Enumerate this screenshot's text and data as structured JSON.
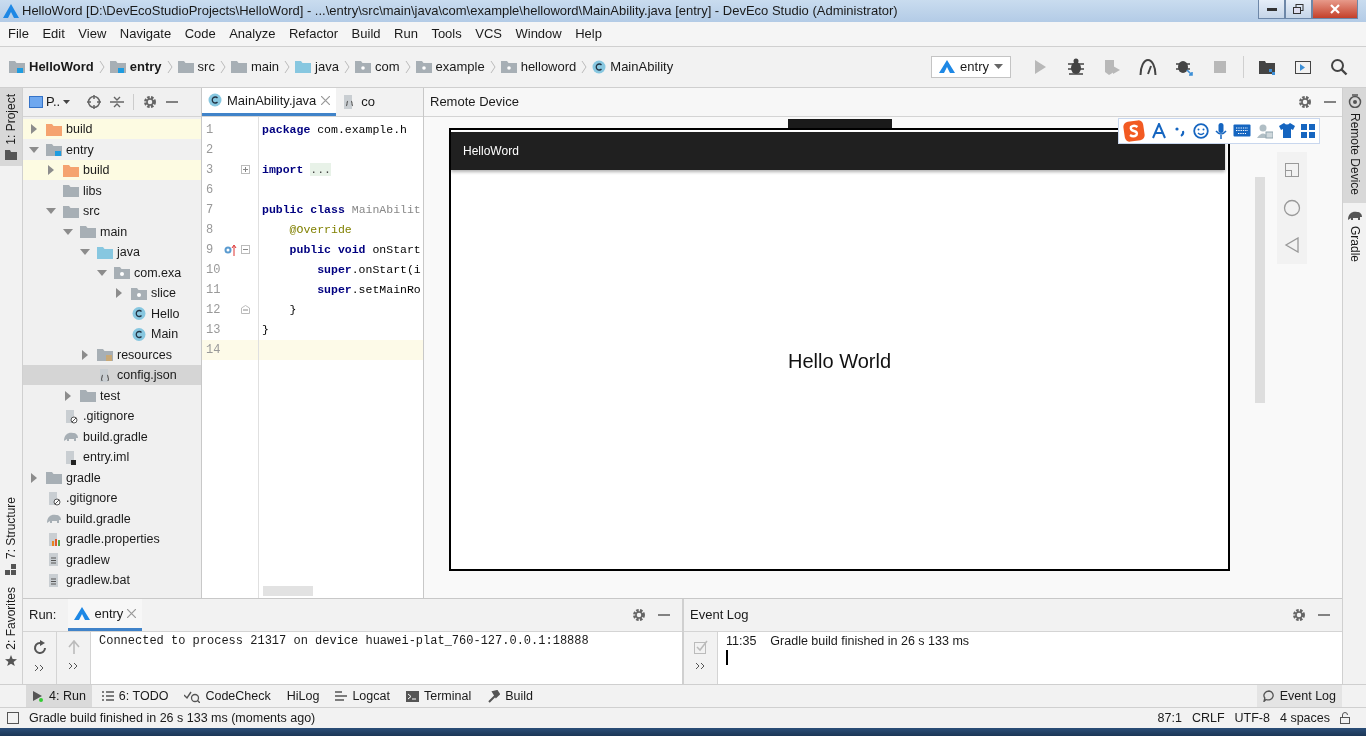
{
  "window": {
    "title": "HelloWord [D:\\DevEcoStudioProjects\\HelloWord] - ...\\entry\\src\\main\\java\\com\\example\\helloword\\MainAbility.java [entry] - DevEco Studio (Administrator)"
  },
  "menu": [
    "File",
    "Edit",
    "View",
    "Navigate",
    "Code",
    "Analyze",
    "Refactor",
    "Build",
    "Run",
    "Tools",
    "VCS",
    "Window",
    "Help"
  ],
  "breadcrumbs": [
    {
      "label": "HelloWord",
      "kind": "module"
    },
    {
      "label": "entry",
      "kind": "module"
    },
    {
      "label": "src",
      "kind": "folder"
    },
    {
      "label": "main",
      "kind": "folder"
    },
    {
      "label": "java",
      "kind": "source"
    },
    {
      "label": "com",
      "kind": "package"
    },
    {
      "label": "example",
      "kind": "package"
    },
    {
      "label": "helloword",
      "kind": "package"
    },
    {
      "label": "MainAbility",
      "kind": "class"
    }
  ],
  "run_config": {
    "label": "entry"
  },
  "toolbar": [
    {
      "kind": "run",
      "disabled": true
    },
    {
      "kind": "debug",
      "disabled": false
    },
    {
      "kind": "attach",
      "disabled": true
    },
    {
      "kind": "profile",
      "disabled": false
    },
    {
      "kind": "attach-debugger",
      "disabled": false
    },
    {
      "kind": "stop",
      "disabled": true
    },
    {
      "kind": "project-structure",
      "disabled": false
    },
    {
      "kind": "device-manager",
      "disabled": false
    },
    {
      "kind": "search",
      "disabled": false
    }
  ],
  "left_stripe": [
    {
      "label": "1: Project",
      "selected": true,
      "kind": "project"
    },
    {
      "label": "7: Structure",
      "selected": false,
      "kind": "structure"
    },
    {
      "label": "2: Favorites",
      "selected": false,
      "kind": "favorites"
    }
  ],
  "project_panel": {
    "title": "P..",
    "tree": [
      {
        "label": "build",
        "kind": "build",
        "expanded": false,
        "selected": false
      },
      {
        "label": "entry",
        "kind": "module",
        "expanded": true,
        "selected": false,
        "children": [
          {
            "label": "build",
            "kind": "build",
            "expanded": false,
            "selected": false
          },
          {
            "label": "libs",
            "kind": "folder",
            "selected": false
          },
          {
            "label": "src",
            "kind": "folder",
            "expanded": true,
            "selected": false,
            "children": [
              {
                "label": "main",
                "kind": "folder",
                "expanded": true,
                "selected": false,
                "children": [
                  {
                    "label": "java",
                    "kind": "source",
                    "expanded": true,
                    "selected": false,
                    "children": [
                      {
                        "label": "com.exa",
                        "kind": "package",
                        "expanded": true,
                        "selected": false,
                        "children": [
                          {
                            "label": "slice",
                            "kind": "package",
                            "expanded": false,
                            "selected": false
                          },
                          {
                            "label": "Hello",
                            "kind": "class",
                            "selected": false
                          },
                          {
                            "label": "Main",
                            "kind": "class",
                            "selected": false
                          }
                        ]
                      }
                    ]
                  },
                  {
                    "label": "resources",
                    "kind": "resources",
                    "expanded": false,
                    "selected": false
                  },
                  {
                    "label": "config.json",
                    "kind": "json",
                    "selected": true
                  }
                ]
              },
              {
                "label": "test",
                "kind": "folder",
                "expanded": false,
                "selected": false
              }
            ]
          },
          {
            "label": ".gitignore",
            "kind": "gitignore",
            "selected": false
          },
          {
            "label": "build.gradle",
            "kind": "gradle",
            "selected": false
          },
          {
            "label": "entry.iml",
            "kind": "iml",
            "selected": false
          }
        ]
      },
      {
        "label": "gradle",
        "kind": "folder",
        "expanded": false,
        "selected": false
      },
      {
        "label": ".gitignore",
        "kind": "gitignore",
        "selected": false
      },
      {
        "label": "build.gradle",
        "kind": "gradle",
        "selected": false
      },
      {
        "label": "gradle.properties",
        "kind": "properties",
        "selected": false
      },
      {
        "label": "gradlew",
        "kind": "text",
        "selected": false
      },
      {
        "label": "gradlew.bat",
        "kind": "text",
        "selected": false
      }
    ]
  },
  "editor": {
    "tabs": [
      {
        "label": "MainAbility.java",
        "kind": "class",
        "selected": true
      },
      {
        "label": "co",
        "kind": "json",
        "selected": false
      }
    ],
    "lines": [
      {
        "number": "1",
        "current": false,
        "segments": [
          {
            "text": "package",
            "kind": "keyword"
          },
          {
            "text": " com.example.h",
            "kind": "plain"
          }
        ]
      },
      {
        "number": "2",
        "current": false
      },
      {
        "number": "3",
        "current": false,
        "collapsed": true,
        "segments": [
          {
            "text": "import",
            "kind": "keyword"
          },
          {
            "text": "...",
            "kind": "folded"
          }
        ]
      },
      {
        "number": "6",
        "current": false
      },
      {
        "number": "7",
        "current": false,
        "segments": [
          {
            "text": "public class",
            "kind": "keyword"
          },
          {
            "text": " MainAbilit",
            "kind": "muted"
          }
        ]
      },
      {
        "number": "8",
        "current": false,
        "segments": [
          {
            "text": "    @Override",
            "kind": "annotation"
          }
        ]
      },
      {
        "number": "9",
        "current": false,
        "collapsed": false,
        "override_marker": true,
        "segments": [
          {
            "text": "    public void",
            "kind": "keyword"
          },
          {
            "text": " onStart",
            "kind": "plain"
          }
        ]
      },
      {
        "number": "10",
        "current": false,
        "segments": [
          {
            "text": "        super",
            "kind": "keyword"
          },
          {
            "text": ".onStart(i",
            "kind": "plain"
          }
        ]
      },
      {
        "number": "11",
        "current": false,
        "segments": [
          {
            "text": "        super",
            "kind": "keyword"
          },
          {
            "text": ".setMainRo",
            "kind": "plain"
          }
        ]
      },
      {
        "number": "12",
        "current": false,
        "fold_end": true,
        "segments": [
          {
            "text": "    }",
            "kind": "plain"
          }
        ]
      },
      {
        "number": "13",
        "current": false,
        "segments": [
          {
            "text": "}",
            "kind": "plain"
          }
        ]
      },
      {
        "number": "14",
        "current": true
      }
    ]
  },
  "remote_device": {
    "title": "Remote Device",
    "app_title": "HelloWord",
    "content": "Hello World"
  },
  "right_stripe": [
    {
      "label": "Remote Device",
      "selected": true,
      "kind": "device"
    },
    {
      "label": "Gradle",
      "selected": false,
      "kind": "gradle"
    }
  ],
  "run_panel": {
    "label": "Run:",
    "tabs": [
      {
        "label": "entry",
        "selected": true
      }
    ],
    "output": "Connected to process 21317 on device huawei-plat_760-127.0.0.1:18888"
  },
  "event_log": {
    "title": "Event Log",
    "entries": [
      {
        "time": "11:35",
        "message": "Gradle build finished in 26 s 133 ms"
      }
    ]
  },
  "tool_windows": [
    {
      "label": "4: Run",
      "kind": "run",
      "selected": true
    },
    {
      "label": "6: TODO",
      "kind": "todo",
      "selected": false
    },
    {
      "label": "CodeCheck",
      "kind": "codecheck",
      "selected": false
    },
    {
      "label": "HiLog",
      "kind": "plain",
      "selected": false
    },
    {
      "label": "Logcat",
      "kind": "logcat",
      "selected": false
    },
    {
      "label": "Terminal",
      "kind": "terminal",
      "selected": false
    },
    {
      "label": "Build",
      "kind": "build",
      "selected": false
    }
  ],
  "event_log_button": {
    "label": "Event Log"
  },
  "status_bar": {
    "message": "Gradle build finished in 26 s 133 ms (moments ago)",
    "position": "87:1",
    "line_separator": "CRLF",
    "encoding": "UTF-8",
    "indent": "4 spaces"
  }
}
